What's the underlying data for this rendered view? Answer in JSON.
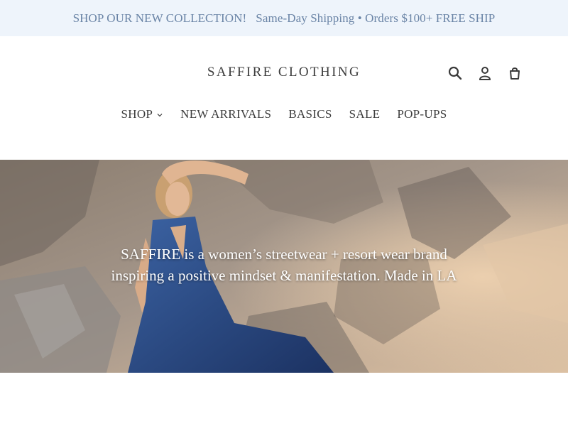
{
  "announcement": {
    "text": "SHOP OUR NEW COLLECTION!   Same-Day Shipping • Orders $100+ FREE SHIP"
  },
  "header": {
    "logo": "SAFFIRE CLOTHING",
    "icons": [
      "search-icon",
      "account-icon",
      "cart-icon"
    ]
  },
  "nav": {
    "items": [
      {
        "label": "SHOP",
        "has_dropdown": true
      },
      {
        "label": "NEW ARRIVALS"
      },
      {
        "label": "BASICS"
      },
      {
        "label": "SALE"
      },
      {
        "label": "POP-UPS"
      }
    ]
  },
  "hero": {
    "line1": "SAFFIRE is a women’s streetwear + resort wear brand",
    "line2": "inspiring a positive mindset & manifestation. Made in LA"
  },
  "colors": {
    "announcement_bg": "#eef4fb",
    "announcement_text": "#6a84a6",
    "dress": "#2e4f86",
    "rock": "#a89a88"
  }
}
